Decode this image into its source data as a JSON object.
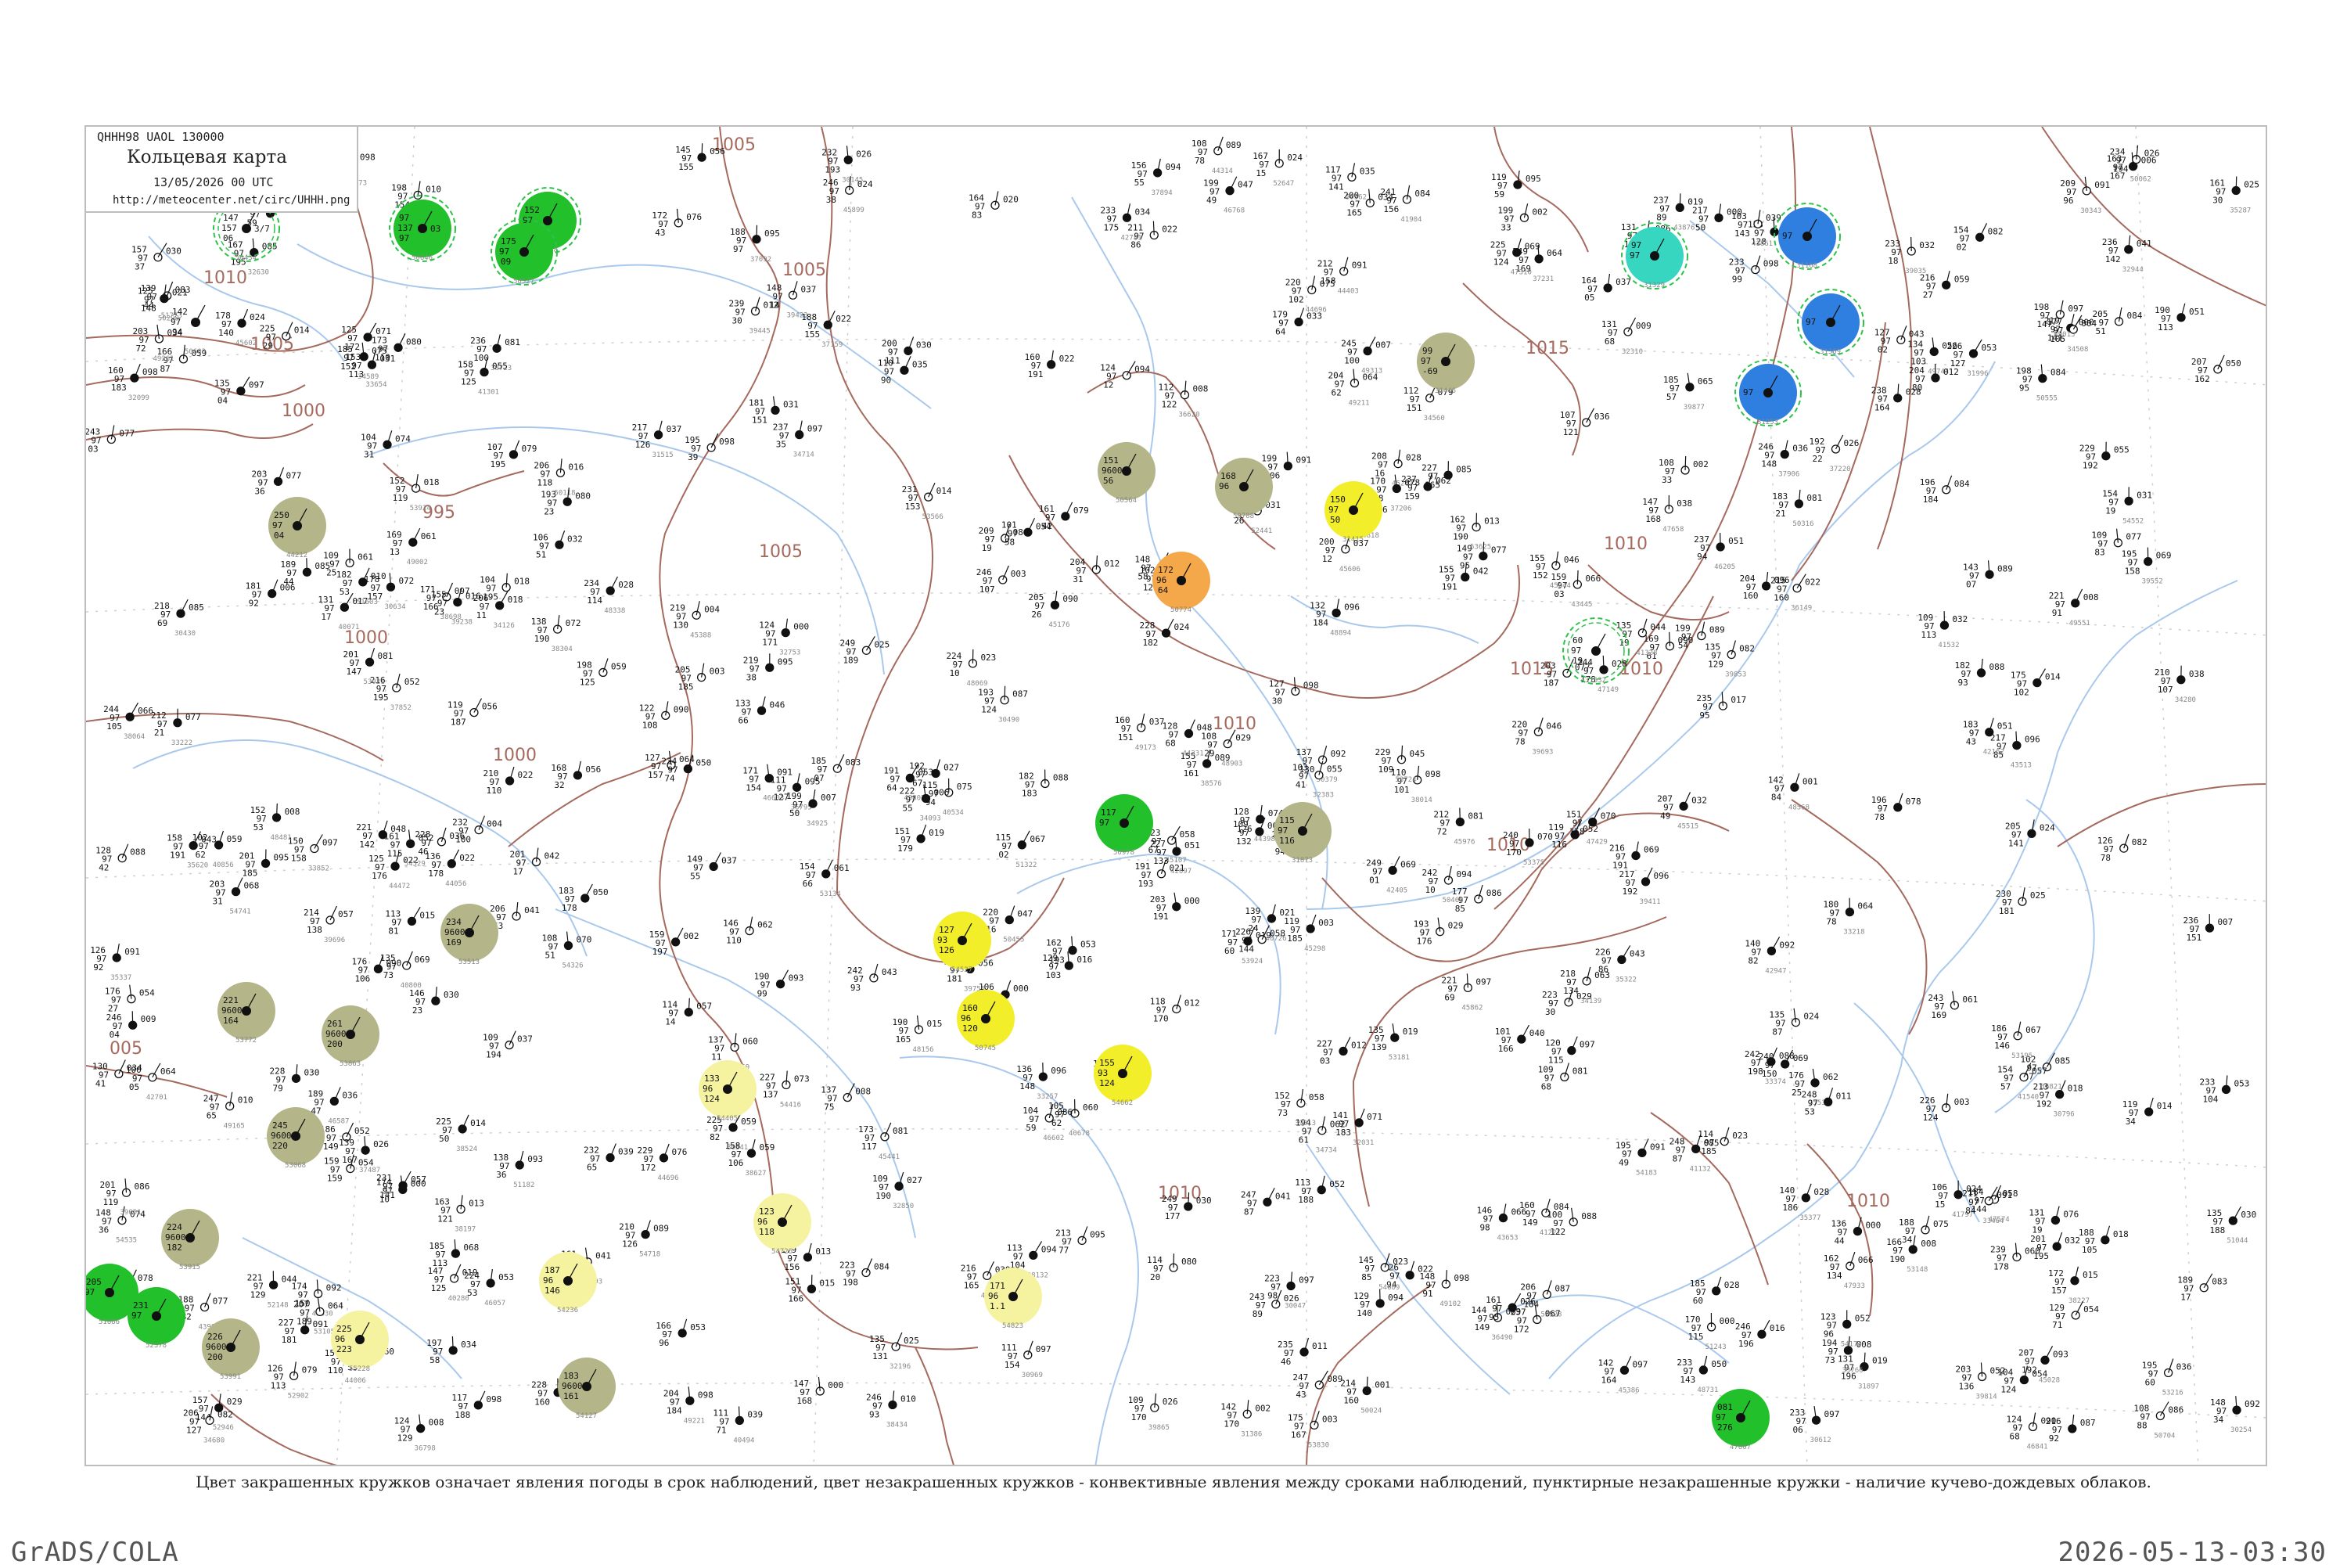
{
  "header": {
    "code_line": "QHHH98  UAOL  130000",
    "title": "Кольцевая карта",
    "date": "13/05/2026 00 UTC",
    "url": "http://meteocenter.net/circ/UHHH.png"
  },
  "caption": "Цвет закрашенных кружков означает явления погоды в срок наблюдений, цвет незакрашенных кружков - конвективные явления между сроками наблюдений, пунктирные незакрашенные кружки - наличие кучево-дождевых облаков.",
  "footer": {
    "left": "GrADS/COLA",
    "right": "2026-05-13-03:30"
  },
  "colors": {
    "isobar": "#a56a5e",
    "river": "#a9c9ec",
    "grid": "#cfcfcf",
    "fill_green": "#22c02a",
    "fill_olive": "#b5b58a",
    "fill_yellow": "#f2ef2a",
    "fill_pale_yellow": "#f6f3a0",
    "fill_orange": "#f5a84a",
    "fill_blue": "#2f7fe0",
    "fill_cyan": "#36d6c0",
    "cb_ring": "#2ec24a"
  },
  "isobar_labels": [
    "1005",
    "1010",
    "1005",
    "1000",
    "995",
    "1005",
    "1000",
    "1000",
    "005",
    "1005",
    "1010",
    "1010",
    "1015",
    "1010",
    "1015",
    "1010",
    "1010",
    "1010"
  ],
  "stations": [
    {
      "index": "50434",
      "top": "147",
      "l1": "157",
      "l2": "06",
      "l3": "3/7",
      "fill": "none",
      "cb": true
    },
    {
      "index": "50646",
      "top": "97",
      "l1": "137",
      "l2": "97",
      "l3": "03",
      "fill": "green",
      "cb": true
    },
    {
      "index": "50548",
      "top": "152",
      "l1": "97",
      "l2": "06",
      "l3": "",
      "fill": "green",
      "cb": true
    },
    {
      "index": "50527",
      "top": "175",
      "l1": "97",
      "l2": "09",
      "l3": "",
      "fill": "green",
      "cb": true
    },
    {
      "index": "50603",
      "top": "142",
      "l1": "97",
      "l2": "94",
      "l3": "",
      "fill": "none",
      "cb": false
    },
    {
      "index": "44212",
      "top": "250",
      "l1": "97",
      "l2": "04",
      "l3": "",
      "fill": "olive",
      "cb": false
    },
    {
      "index": "53068",
      "top": "245",
      "l1": "9600",
      "l2": "220",
      "l3": "",
      "fill": "olive",
      "cb": false
    },
    {
      "index": "53772",
      "top": "221",
      "l1": "9600",
      "l2": "164",
      "l3": "",
      "fill": "olive",
      "cb": false
    },
    {
      "index": "53863",
      "top": "261",
      "l1": "9600",
      "l2": "200",
      "l3": "",
      "fill": "olive",
      "cb": false
    },
    {
      "index": "53513",
      "top": "234",
      "l1": "9600",
      "l2": "169",
      "l3": "",
      "fill": "olive",
      "cb": false
    },
    {
      "index": "53915",
      "top": "224",
      "l1": "9600",
      "l2": "182",
      "l3": "",
      "fill": "olive",
      "cb": false
    },
    {
      "index": "53991",
      "top": "226",
      "l1": "9600",
      "l2": "200",
      "l3": "",
      "fill": "olive",
      "cb": false
    },
    {
      "index": "54127",
      "top": "183",
      "l1": "9600",
      "l2": "161",
      "l3": "",
      "fill": "olive",
      "cb": false
    },
    {
      "index": "54236",
      "top": "187",
      "l1": "96",
      "l2": "146",
      "l3": "",
      "fill": "pale-yellow",
      "cb": false
    },
    {
      "index": "54405",
      "top": "133",
      "l1": "96",
      "l2": "124",
      "l3": "",
      "fill": "pale-yellow",
      "cb": false
    },
    {
      "index": "54527",
      "top": "127",
      "l1": "93",
      "l2": "126",
      "l3": "",
      "fill": "yellow",
      "cb": false
    },
    {
      "index": "50745",
      "top": "160",
      "l1": "96",
      "l2": "120",
      "l3": "",
      "fill": "yellow",
      "cb": false
    },
    {
      "index": "54662",
      "top": "155",
      "l1": "93",
      "l2": "124",
      "l3": "",
      "fill": "yellow",
      "cb": false
    },
    {
      "index": "50564",
      "top": "151",
      "l1": "9600",
      "l2": "56",
      "l3": "",
      "fill": "olive",
      "cb": false
    },
    {
      "index": "50774",
      "top": "172",
      "l1": "96",
      "l2": "64",
      "l3": "",
      "fill": "orange",
      "cb": false
    },
    {
      "index": "50978",
      "top": "117",
      "l1": "97",
      "l2": "",
      "l3": "",
      "fill": "green",
      "cb": false
    },
    {
      "index": "31873",
      "top": "115",
      "l1": "97",
      "l2": "116",
      "l3": "",
      "fill": "olive",
      "cb": false
    },
    {
      "index": "31415",
      "top": "150",
      "l1": "97",
      "l2": "50",
      "l3": "",
      "fill": "yellow",
      "cb": false
    },
    {
      "index": "31532",
      "top": "60",
      "l1": "97",
      "l2": "19",
      "l3": "",
      "fill": "none",
      "cb": true
    },
    {
      "index": "31446",
      "top": "99",
      "l1": "97",
      "l2": "-69",
      "l3": "",
      "fill": "olive",
      "cb": false
    },
    {
      "index": "31329",
      "top": "97",
      "l1": "97",
      "l2": "",
      "l3": "",
      "fill": "cyan",
      "cb": true
    },
    {
      "index": "31168",
      "top": "",
      "l1": "97",
      "l2": "",
      "l3": "",
      "fill": "blue",
      "cb": true
    },
    {
      "index": "31369",
      "top": "",
      "l1": "97",
      "l2": "",
      "l3": "",
      "fill": "blue",
      "cb": true
    },
    {
      "index": "31253",
      "top": "",
      "l1": "97",
      "l2": "",
      "l3": "",
      "fill": "blue",
      "cb": true
    },
    {
      "index": "47807",
      "top": "081",
      "l1": "97",
      "l2": "276",
      "l3": "",
      "fill": "green",
      "cb": false
    },
    {
      "index": "51886",
      "top": "205",
      "l1": "97",
      "l2": "",
      "l3": "",
      "fill": "green",
      "cb": false
    },
    {
      "index": "52378",
      "top": "231",
      "l1": "97",
      "l2": "",
      "l3": "",
      "fill": "green",
      "cb": false
    },
    {
      "index": "54823",
      "top": "171",
      "l1": "96",
      "l2": "1.1",
      "l3": "",
      "fill": "pale-yellow",
      "cb": false
    },
    {
      "index": "55228",
      "top": "225",
      "l1": "96",
      "l2": "223",
      "l3": "",
      "fill": "pale-yellow",
      "cb": false
    },
    {
      "index": "54726",
      "top": "123",
      "l1": "96",
      "l2": "118",
      "l3": "",
      "fill": "pale-yellow",
      "cb": false
    },
    {
      "index": "50788",
      "top": "168",
      "l1": "96",
      "l2": "",
      "l3": "",
      "fill": "olive",
      "cb": false
    }
  ]
}
